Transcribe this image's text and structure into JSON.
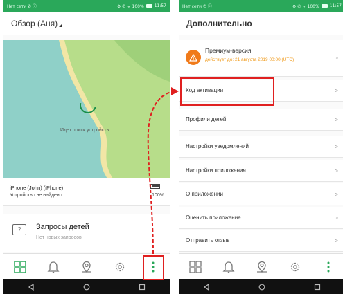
{
  "left": {
    "status": {
      "left": "Нет сети ✆ ⓘ",
      "right": "⚙ ✆ ᯤ 100%",
      "time": "11:57"
    },
    "header_title": "Обзор (Аня)",
    "map_status": "Идет поиск устройств...",
    "device": {
      "name": "iPhone (John) (iPhone)",
      "status": "Устройство не найдено",
      "battery": "100%"
    },
    "requests": {
      "title": "Запросы детей",
      "subtitle": "Нет новых запросов"
    },
    "colors": {
      "accent": "#2aa85a",
      "map_water": "#8fd0c8",
      "map_land": "#b7dd8a"
    }
  },
  "right": {
    "status": {
      "left": "Нет сети ✆ ⓘ",
      "right": "⚙ ✆ ᯤ 100%",
      "time": "11:57"
    },
    "header_title": "Дополнительно",
    "premium": {
      "title": "Премиум-версия",
      "subtitle": "действует до: 21 августа 2019 00:00 (UTC)"
    },
    "items": [
      {
        "label": "Код активации"
      },
      {
        "label": "Профили детей"
      },
      {
        "label": "Настройки уведомлений"
      },
      {
        "label": "Настройки приложения"
      },
      {
        "label": "О приложении"
      },
      {
        "label": "Оценить приложение"
      },
      {
        "label": "Отправить отзыв"
      }
    ],
    "chevron": ">"
  },
  "icons": {
    "nav": [
      "dashboard-icon",
      "bell-icon",
      "location-pin-icon",
      "gear-icon",
      "more-vertical-icon"
    ],
    "system": [
      "back-icon",
      "home-icon",
      "recents-icon"
    ]
  },
  "annotation_color": "#e02020"
}
